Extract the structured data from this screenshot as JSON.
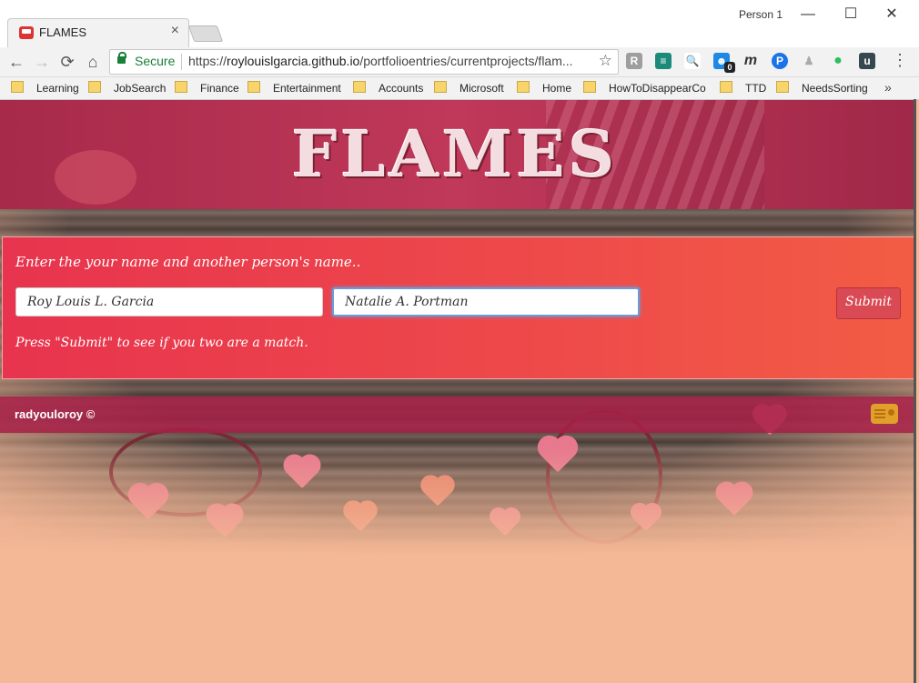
{
  "browser": {
    "tab_title": "FLAMES",
    "tab_close": "×",
    "profile": "Person 1",
    "win_min": "—",
    "win_max": "☐",
    "win_close": "✕",
    "nav": {
      "back": "←",
      "forward": "→",
      "reload": "⟳",
      "home": "⌂"
    },
    "address": {
      "security_label": "Secure",
      "scheme": "https://",
      "host": "roylouislgarcia.github.io",
      "path": "/portfolioentries/currentprojects/flam..."
    },
    "star": "☆",
    "menu": "⋮",
    "extensions": [
      {
        "icon": "letter-r-icon",
        "glyph": "R",
        "color": "#9e9e9e"
      },
      {
        "icon": "feedly-icon",
        "glyph": "≡",
        "color": "#1b8a7a"
      },
      {
        "icon": "magnifier-icon",
        "glyph": "🔍",
        "color": "#ffffff"
      },
      {
        "icon": "mascot-icon",
        "glyph": "☻",
        "color": "#1e88e5"
      },
      {
        "icon": "letter-m-icon",
        "glyph": "m",
        "color": "#ffffff"
      },
      {
        "icon": "pushbullet-icon",
        "glyph": "P",
        "color": "#1a73e8"
      },
      {
        "icon": "android-icon",
        "glyph": "♟",
        "color": "#bbbbbb"
      },
      {
        "icon": "evernote-icon",
        "glyph": "●",
        "color": "#2dbe60"
      },
      {
        "icon": "u-icon",
        "glyph": "u",
        "color": "#37474f"
      }
    ],
    "extension_badge": "0",
    "bookmarks": [
      "Learning",
      "JobSearch",
      "Finance",
      "Entertainment",
      "Accounts",
      "Microsoft",
      "Home",
      "HowToDisappearCor",
      "TTD",
      "NeedsSorting"
    ],
    "bookmarks_more": "»"
  },
  "page": {
    "logo": "FLAMES",
    "prompt": "Enter the your name and another person's name..",
    "name1_value": "Roy Louis L. Garcia",
    "name2_value": "Natalie A. Portman",
    "submit_label": "Submit",
    "hint": "Press \"Submit\" to see if you two are a match.",
    "footer_text": "radyouloroy ©",
    "colors": {
      "banner": "#b8344f",
      "panel": "#ea3b4c",
      "footer": "#a82048",
      "page_bg": "#f5b896"
    }
  }
}
